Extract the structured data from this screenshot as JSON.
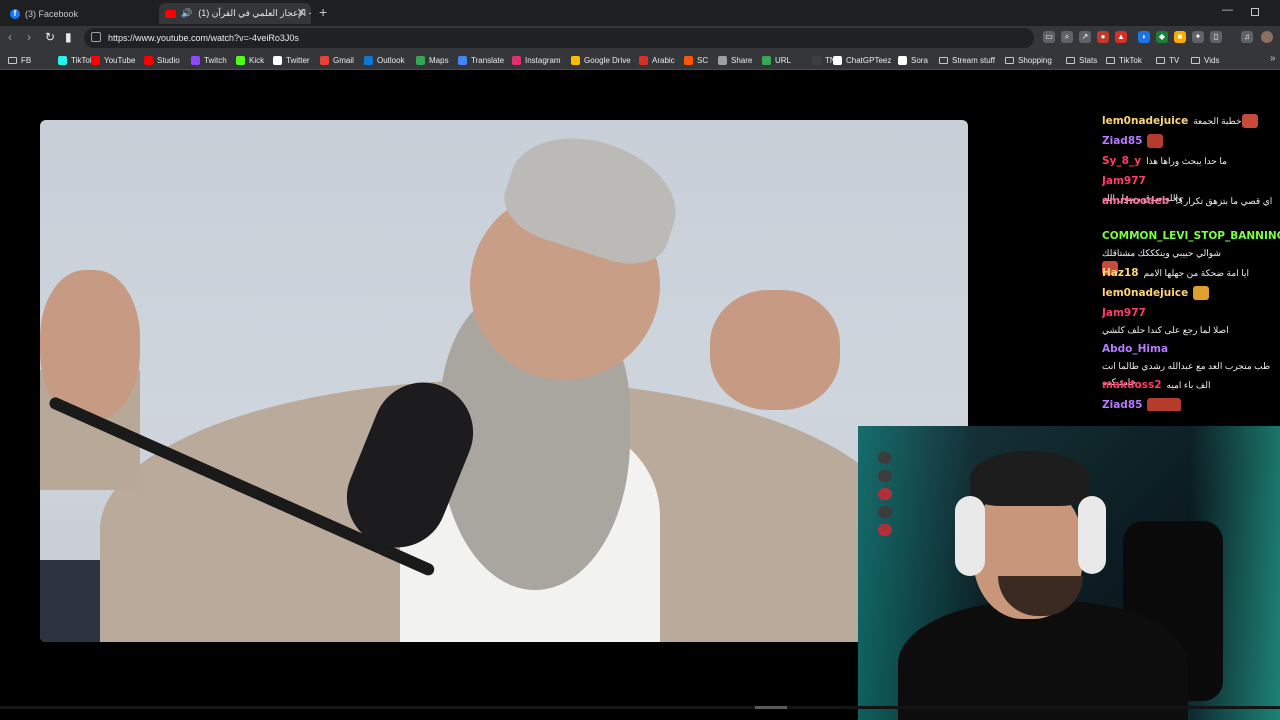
{
  "browser": {
    "tabs": [
      {
        "title": "(3) Facebook",
        "favicon": "facebook-icon"
      },
      {
        "title": "(1) الإعجاز العلمي في القرآن -",
        "favicon": "youtube-icon",
        "audio": "speaker-icon",
        "active": true
      }
    ],
    "url": "https://www.youtube.com/watch?v=-4veiRo3J0s"
  },
  "bookmarks": [
    {
      "label": "FB",
      "icon": "folder-icon"
    },
    {
      "label": "TikTok",
      "icon": "tiktok-icon",
      "color": "#25f4ee"
    },
    {
      "label": "YouTube",
      "icon": "youtube-icon",
      "color": "#ff0000"
    },
    {
      "label": "Studio",
      "icon": "youtube-studio-icon",
      "color": "#ff0000"
    },
    {
      "label": "Twitch",
      "icon": "twitch-icon",
      "color": "#9146ff"
    },
    {
      "label": "Kick",
      "icon": "kick-icon",
      "color": "#53fc18"
    },
    {
      "label": "Twitter",
      "icon": "x-icon",
      "color": "#ffffff"
    },
    {
      "label": "Gmail",
      "icon": "gmail-icon",
      "color": "#ea4335"
    },
    {
      "label": "Outlook",
      "icon": "outlook-icon",
      "color": "#0f78d4"
    },
    {
      "label": "Maps",
      "icon": "maps-icon",
      "color": "#34a853"
    },
    {
      "label": "Translate",
      "icon": "translate-icon",
      "color": "#4285f4"
    },
    {
      "label": "Instagram",
      "icon": "instagram-icon",
      "color": "#e1306c"
    },
    {
      "label": "Google Drive",
      "icon": "drive-icon",
      "color": "#fbbc04"
    },
    {
      "label": "Arabic",
      "icon": "arabic-icon",
      "color": "#d93025"
    },
    {
      "label": "SC",
      "icon": "soundcloud-icon",
      "color": "#ff5500"
    },
    {
      "label": "Share",
      "icon": "cloud-icon",
      "color": "#9aa0a6"
    },
    {
      "label": "URL",
      "icon": "url-icon",
      "color": "#34a853"
    },
    {
      "label": "TN",
      "icon": "tn-icon",
      "color": "#3c4043"
    },
    {
      "label": "ChatGPTeez",
      "icon": "chatgpt-icon",
      "color": "#ffffff"
    },
    {
      "label": "Sora",
      "icon": "sora-icon",
      "color": "#ffffff"
    },
    {
      "label": "Stream stuff",
      "icon": "folder-icon"
    },
    {
      "label": "Shopping",
      "icon": "folder-icon"
    },
    {
      "label": "Stats",
      "icon": "folder-icon"
    },
    {
      "label": "TikTok",
      "icon": "folder-icon"
    },
    {
      "label": "TV",
      "icon": "folder-icon"
    },
    {
      "label": "Vids",
      "icon": "folder-icon"
    }
  ],
  "chat": [
    {
      "user": "lem0nadejuice",
      "color": "#ffd37a",
      "text": "خطبة الجمعة",
      "emote": true
    },
    {
      "user": "Ziad85",
      "color": "#b57cff",
      "text": "",
      "emote": true
    },
    {
      "user": "Sy_8_y",
      "color": "#ff3d68",
      "text": "ما حدا يبحث وراها هذا"
    },
    {
      "user": "Jam977",
      "color": "#ff3d68",
      "text": "والله صدق رسول الله"
    },
    {
      "user": "amrhoodeb",
      "color": "#ff6fa1",
      "text": "اي قصي ما بتزهق تكرار؟؟"
    },
    {
      "user": "COMMON_LEVI_STOP_BANNING",
      "color": "#7dff3d",
      "text": "شوالي حبيبي وينكككك مشتاقلك",
      "emote": true
    },
    {
      "user": "Haz18",
      "color": "#ffd37a",
      "text": "ايا امة ضحكة من جهلها الامم"
    },
    {
      "user": "lem0nadejuice",
      "color": "#ffd37a",
      "text": "",
      "emote": true
    },
    {
      "user": "Jam977",
      "color": "#ff3d68",
      "text": "اصلا لما رجع على كندا حلف كلشي"
    },
    {
      "user": "Abdo_Hima",
      "color": "#b57cff",
      "text": "طب متجرب العد مع عبدالله رشدي طالما انت جامد كده"
    },
    {
      "user": "makdoss2",
      "color": "#ff3d68",
      "text": "الف باء اميه"
    },
    {
      "user": "Ziad85",
      "color": "#b57cff",
      "text": "",
      "emote": true
    }
  ]
}
